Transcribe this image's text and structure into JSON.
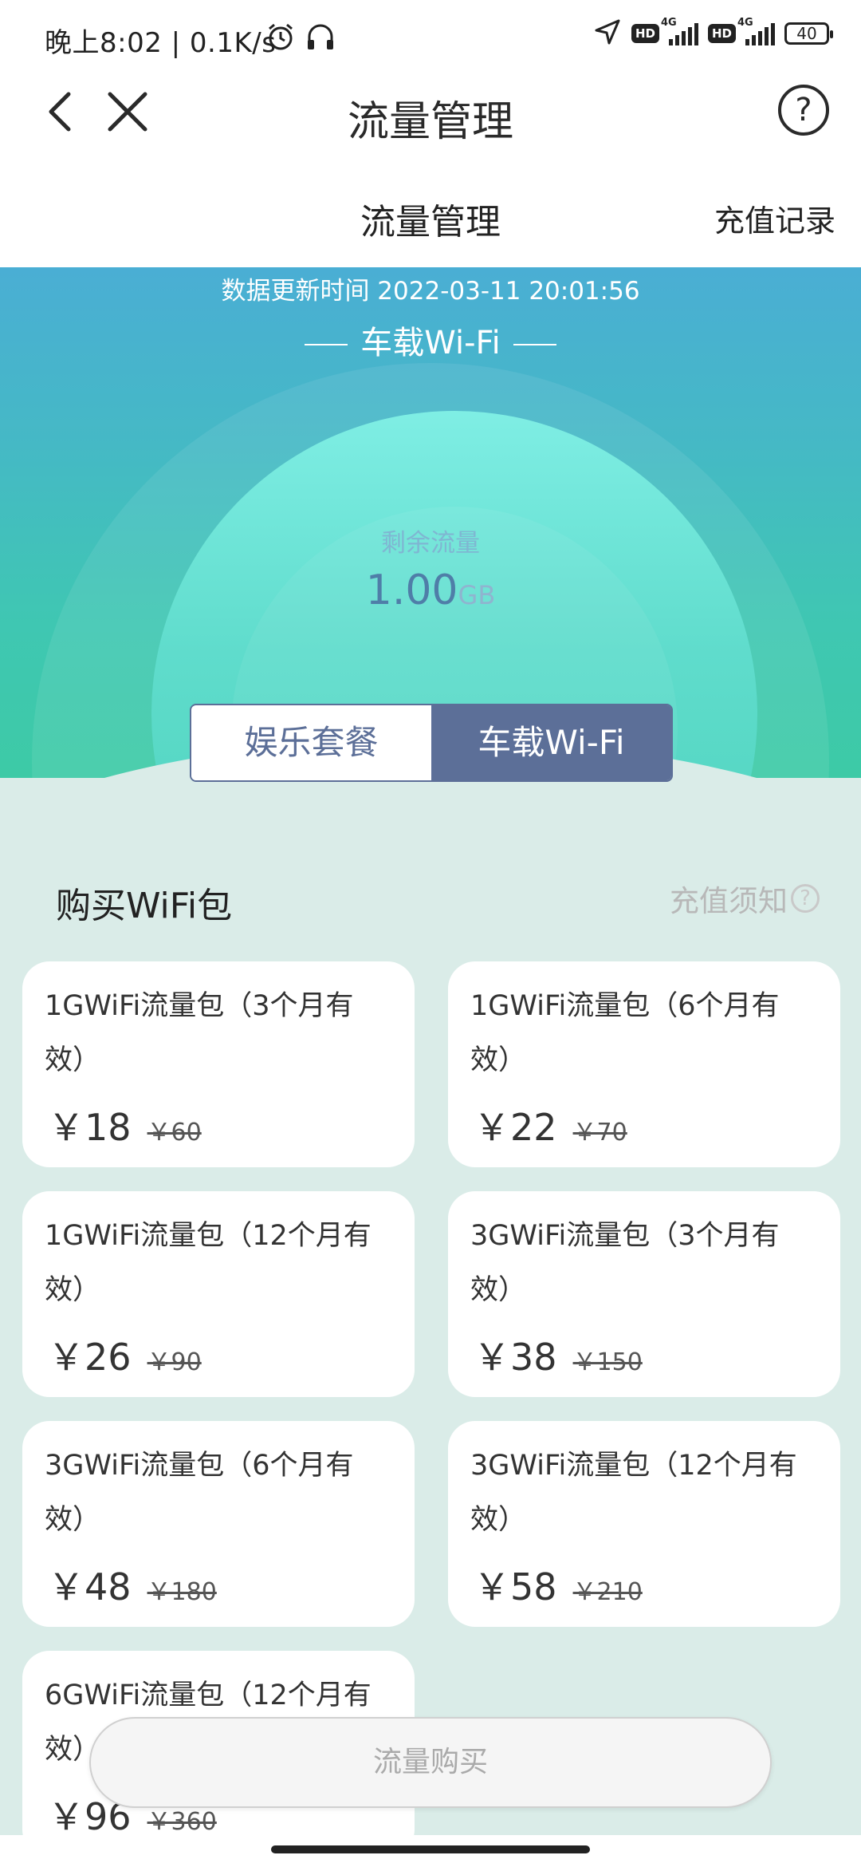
{
  "status_bar": {
    "time": "晚上8:02 | 0.1K/s",
    "hd1": "HD",
    "net1": "4G",
    "hd2": "HD",
    "net2": "4G",
    "battery": "40"
  },
  "nav": {
    "title": "流量管理"
  },
  "tabs": {
    "main": "流量管理",
    "record": "充值记录"
  },
  "hero": {
    "update_time": "数据更新时间 2022-03-11 20:01:56",
    "device_title": "车载Wi-Fi",
    "remain_label": "剩余流量",
    "remain_value": "1.00",
    "remain_unit": "GB",
    "carousel_active_index": 1
  },
  "segment": {
    "options": [
      "娱乐套餐",
      "车载Wi-Fi"
    ],
    "selected": "车载Wi-Fi"
  },
  "section": {
    "title": "购买WiFi包",
    "notice": "充值须知",
    "notice_icon": "?"
  },
  "packages": [
    {
      "name": "1GWiFi流量包（3个月有效）",
      "price": "￥18",
      "original": "￥60"
    },
    {
      "name": "1GWiFi流量包（6个月有效）",
      "price": "￥22",
      "original": "￥70"
    },
    {
      "name": "1GWiFi流量包（12个月有效）",
      "price": "￥26",
      "original": "￥90"
    },
    {
      "name": "3GWiFi流量包（3个月有效）",
      "price": "￥38",
      "original": "￥150"
    },
    {
      "name": "3GWiFi流量包（6个月有效）",
      "price": "￥48",
      "original": "￥180"
    },
    {
      "name": "3GWiFi流量包（12个月有效）",
      "price": "￥58",
      "original": "￥210"
    },
    {
      "name": "6GWiFi流量包（12个月有效）",
      "price": "￥96",
      "original": "￥360"
    }
  ],
  "buy_button": "流量购买",
  "colors": {
    "accent": "#5c6f98",
    "hero_top": "#4aaed4",
    "hero_bottom": "#3dcaa6",
    "page_bg": "#daece8"
  }
}
